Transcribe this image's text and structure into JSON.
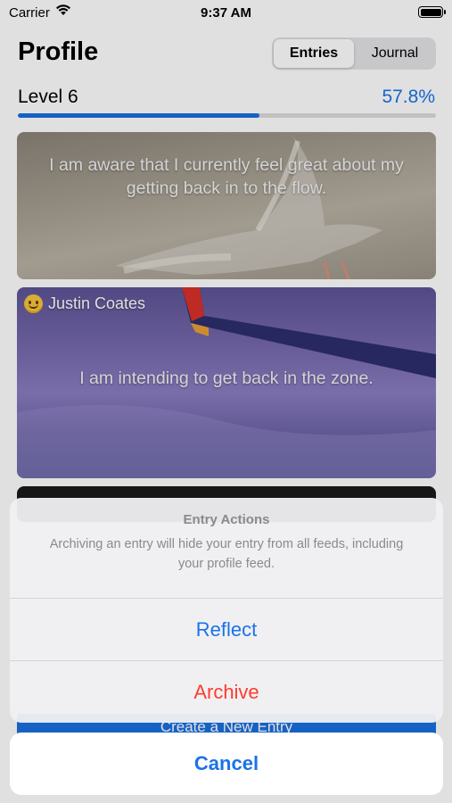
{
  "status_bar": {
    "carrier": "Carrier",
    "time": "9:37 AM"
  },
  "header": {
    "title": "Profile",
    "segments": [
      {
        "label": "Entries",
        "selected": true
      },
      {
        "label": "Journal",
        "selected": false
      }
    ]
  },
  "level": {
    "label": "Level 6",
    "percent_text": "57.8%",
    "progress": 0.578
  },
  "cards": [
    {
      "text": "I am aware that I currently feel great about my getting back in to the flow."
    },
    {
      "user": "Justin Coates",
      "text": "I am intending to get back in the zone."
    }
  ],
  "new_entry_label": "Create a New Entry",
  "action_sheet": {
    "title": "Entry Actions",
    "message": "Archiving an entry will hide your entry from all feeds, including your profile feed.",
    "actions": [
      {
        "label": "Reflect"
      },
      {
        "label": "Archive",
        "destructive": true
      }
    ],
    "cancel_label": "Cancel"
  },
  "colors": {
    "accent": "#1a73e8",
    "destructive": "#ff3b30",
    "progress": "#1a6fe0"
  }
}
